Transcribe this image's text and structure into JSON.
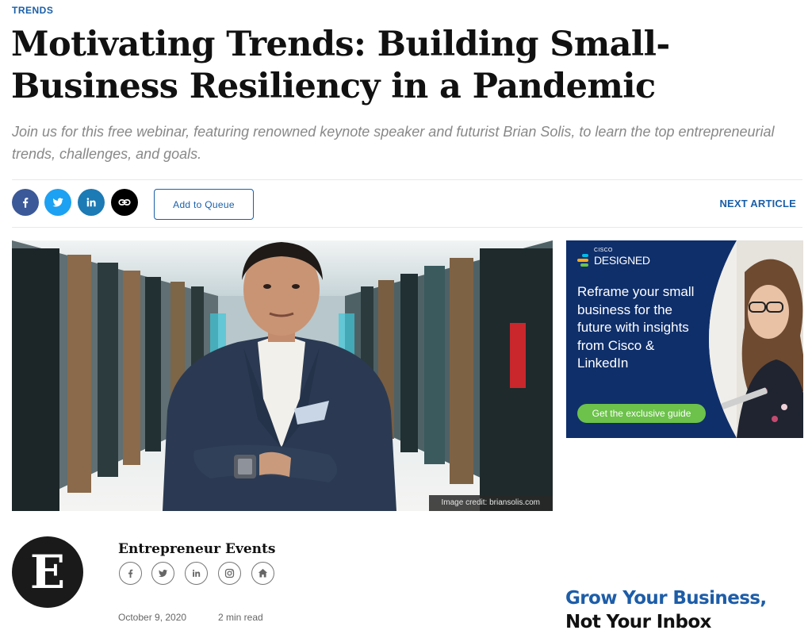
{
  "article": {
    "category": "TRENDS",
    "headline": "Motivating Trends: Building Small-Business Resiliency in a Pandemic",
    "dek": "Join us for this free webinar, featuring renowned keynote speaker and futurist Brian Solis, to learn the top entrepreneurial trends, challenges, and goals.",
    "image_credit": "Image credit: briansolis.com",
    "date": "October 9, 2020",
    "read_time": "2 min read"
  },
  "toolbar": {
    "share_icons": [
      "facebook-icon",
      "twitter-icon",
      "linkedin-icon",
      "link-icon"
    ],
    "add_to_queue_label": "Add to Queue",
    "next_article_label": "NEXT ARTICLE"
  },
  "ad": {
    "brand_small": "CISCO",
    "brand": "DESIGNED",
    "copy": "Reframe your small business for the future with insights from Cisco & LinkedIn",
    "cta": "Get the exclusive guide",
    "colors": {
      "background": "#0f2f6b",
      "cta": "#6cc24a"
    }
  },
  "author": {
    "logo_letter": "E",
    "name": "Entrepreneur Events",
    "social_icons": [
      "facebook-icon",
      "twitter-icon",
      "linkedin-icon",
      "instagram-icon",
      "home-icon"
    ]
  },
  "promo": {
    "line1": "Grow Your Business,",
    "line2": "Not Your Inbox"
  },
  "colors": {
    "accent": "#1a5fa8",
    "headline": "#111111",
    "dek": "#888888"
  }
}
